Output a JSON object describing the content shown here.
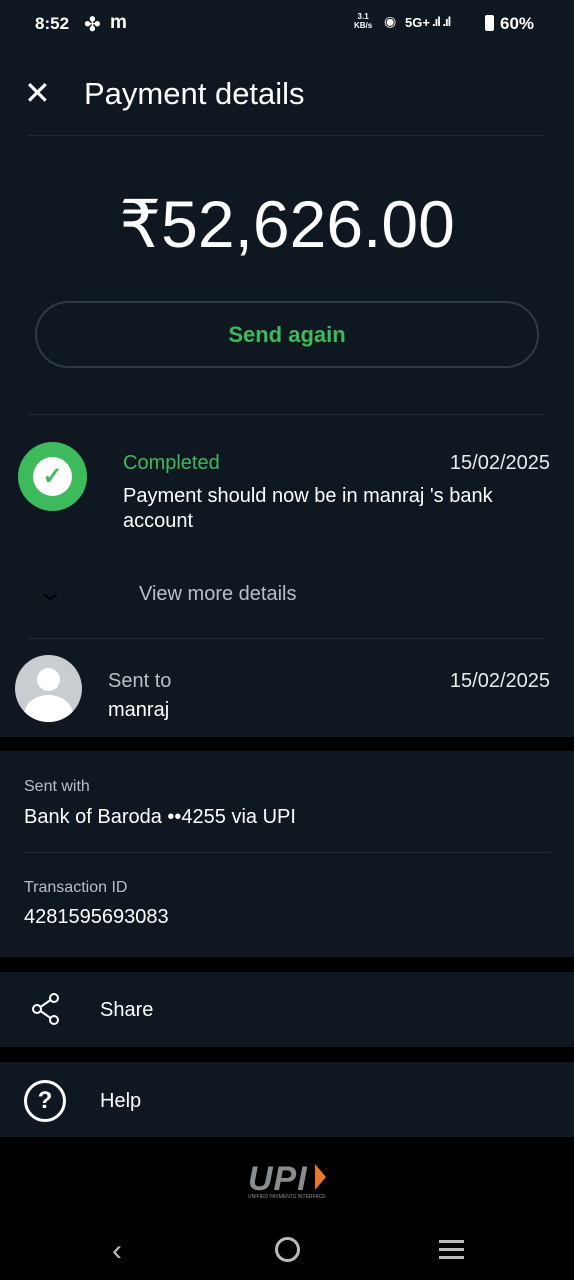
{
  "status_bar": {
    "time": "8:52",
    "app_icon_1": "fan-icon",
    "app_icon_2": "m",
    "speed_value": "3.1",
    "speed_unit": "KB/s",
    "network": "5G+",
    "battery": "60%"
  },
  "header": {
    "title": "Payment details"
  },
  "amount": "₹52,626.00",
  "send_again": "Send again",
  "status": {
    "label": "Completed",
    "date": "15/02/2025",
    "message": "Payment should now be in manraj 's bank account",
    "view_more": "View more details"
  },
  "recipient": {
    "label": "Sent to",
    "name": "manraj",
    "date": "15/02/2025"
  },
  "details": {
    "sent_with_label": "Sent with",
    "sent_with_value": "Bank of Baroda ••4255 via UPI",
    "txn_label": "Transaction ID",
    "txn_value": "4281595693083"
  },
  "actions": {
    "share": "Share",
    "help": "Help"
  },
  "footer": {
    "logo": "UPI",
    "logo_sub": "UNIFIED PAYMENTS INTERFACE"
  },
  "colors": {
    "accent": "#3dba5b",
    "bg": "#0f1821"
  }
}
